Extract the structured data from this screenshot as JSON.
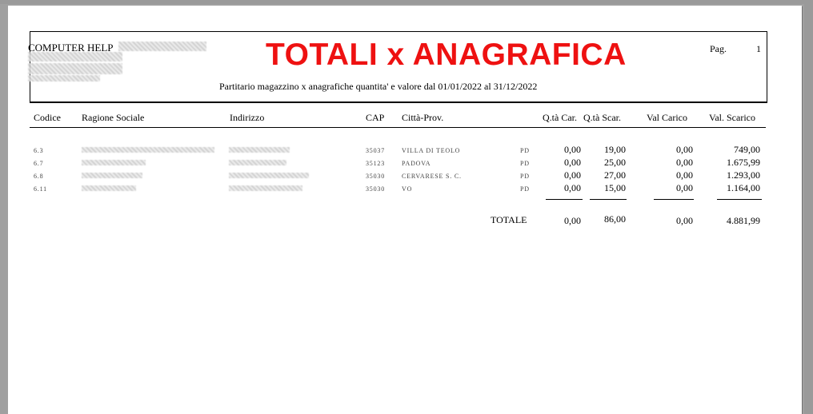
{
  "report": {
    "company": "COMPUTER HELP",
    "title": "TOTALI x ANAGRAFICA",
    "page_label": "Pag.",
    "page_number": "1",
    "subtitle": "Partitario magazzino x anagrafiche quantita' e valore dal 01/01/2022 al 31/12/2022"
  },
  "columns": {
    "codice": "Codice",
    "ragione_sociale": "Ragione Sociale",
    "indirizzo": "Indirizzo",
    "cap": "CAP",
    "citta": "Città-Prov.",
    "qta_car": "Q.tà Car.",
    "qta_scar": "Q.tà Scar.",
    "val_carico": "Val Carico",
    "val_scarico": "Val. Scarico"
  },
  "rows": [
    {
      "codice": "6.3",
      "cap": "35037",
      "citta": "VILLA DI TEOLO",
      "prov": "PD",
      "qta_car": "0,00",
      "qta_scar": "19,00",
      "val_carico": "0,00",
      "val_scarico": "749,00"
    },
    {
      "codice": "6.7",
      "cap": "35123",
      "citta": "PADOVA",
      "prov": "PD",
      "qta_car": "0,00",
      "qta_scar": "25,00",
      "val_carico": "0,00",
      "val_scarico": "1.675,99"
    },
    {
      "codice": "6.8",
      "cap": "35030",
      "citta": "CERVARESE S. C.",
      "prov": "PD",
      "qta_car": "0,00",
      "qta_scar": "27,00",
      "val_carico": "0,00",
      "val_scarico": "1.293,00"
    },
    {
      "codice": "6.11",
      "cap": "35030",
      "citta": "VO",
      "prov": "PD",
      "qta_car": "0,00",
      "qta_scar": "15,00",
      "val_carico": "0,00",
      "val_scarico": "1.164,00"
    }
  ],
  "totals": {
    "label": "TOTALE",
    "qta_car": "0,00",
    "qta_scar": "86,00",
    "val_carico": "0,00",
    "val_scarico": "4.881,99"
  }
}
